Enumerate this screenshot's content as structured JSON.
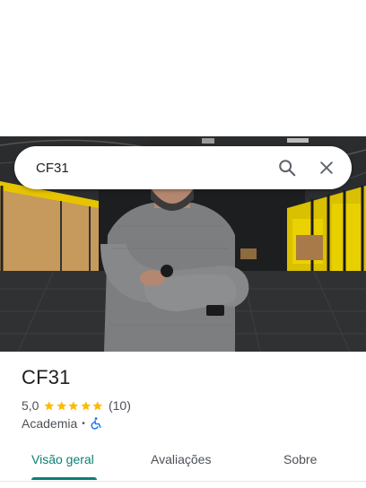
{
  "search": {
    "query": "CF31"
  },
  "place": {
    "name": "CF31",
    "rating": "5,0",
    "stars": 5,
    "review_count": "(10)",
    "category": "Academia",
    "separator": "•"
  },
  "tabs": [
    {
      "label": "Visão geral",
      "active": true
    },
    {
      "label": "Avaliações",
      "active": false
    },
    {
      "label": "Sobre",
      "active": false
    }
  ],
  "colors": {
    "accent": "#0b7f75",
    "star": "#fbbc04",
    "accessibility": "#1a73e8"
  },
  "icons": {
    "search": "search-icon",
    "close": "close-icon",
    "star": "star-icon",
    "accessibility": "wheelchair-icon"
  }
}
